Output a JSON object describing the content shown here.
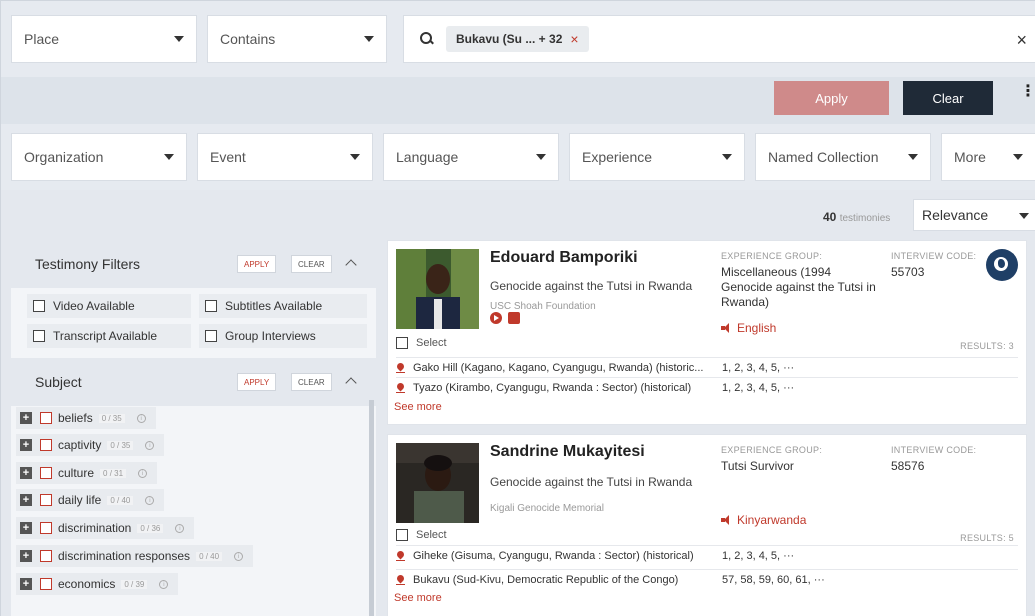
{
  "search": {
    "field_select": "Place",
    "operator_select": "Contains",
    "chip_label": "Bukavu (Su ... + 32",
    "chip_remove": "×",
    "close": "×"
  },
  "actions": {
    "apply_label": "Apply",
    "clear_label": "Clear",
    "more": "⋮"
  },
  "filters": [
    "Organization",
    "Event",
    "Language",
    "Experience",
    "Named Collection",
    "More"
  ],
  "results_meta": {
    "count": "40",
    "count_unit": "testimonies",
    "sort": "Relevance"
  },
  "testimony_filters": {
    "title": "Testimony Filters",
    "apply": "APPLY",
    "clear": "CLEAR",
    "options": [
      "Video Available",
      "Subtitles Available",
      "Transcript Available",
      "Group Interviews"
    ]
  },
  "subject": {
    "title": "Subject",
    "apply": "APPLY",
    "clear": "CLEAR",
    "items": [
      {
        "label": "beliefs",
        "count": "0 / 35"
      },
      {
        "label": "captivity",
        "count": "0 / 35"
      },
      {
        "label": "culture",
        "count": "0 / 31"
      },
      {
        "label": "daily life",
        "count": "0 / 40"
      },
      {
        "label": "discrimination",
        "count": "0 / 36"
      },
      {
        "label": "discrimination responses",
        "count": "0 / 40"
      },
      {
        "label": "economics",
        "count": "0 / 39"
      }
    ]
  },
  "cards": [
    {
      "name": "Edouard Bamporiki",
      "event": "Genocide against the Tutsi in Rwanda",
      "org": "USC Shoah Foundation",
      "exp_label": "EXPERIENCE GROUP:",
      "exp_value": "Miscellaneous (1994 Genocide against the Tutsi in Rwanda)",
      "ic_label": "INTERVIEW CODE:",
      "ic_value": "55703",
      "language": "English",
      "select": "Select",
      "results": "RESULTS: 3",
      "locations": [
        {
          "place": "Gako Hill (Kagano, Kagano, Cyangugu, Rwanda) (historic...",
          "segments": "1, 2, 3, 4, 5, ···"
        },
        {
          "place": "Tyazo (Kirambo, Cyangugu, Rwanda : Sector) (historical)",
          "segments": "1, 2, 3, 4, 5, ···"
        }
      ],
      "see_more": "See more"
    },
    {
      "name": "Sandrine Mukayitesi",
      "event": "Genocide against the Tutsi in Rwanda",
      "org": "Kigali Genocide Memorial",
      "exp_label": "EXPERIENCE GROUP:",
      "exp_value": "Tutsi Survivor",
      "ic_label": "INTERVIEW CODE:",
      "ic_value": "58576",
      "language": "Kinyarwanda",
      "select": "Select",
      "results": "RESULTS: 5",
      "locations": [
        {
          "place": "Giheke (Gisuma, Cyangugu, Rwanda : Sector) (historical)",
          "segments": "1, 2, 3, 4, 5, ···"
        },
        {
          "place": "Bukavu (Sud-Kivu, Democratic Republic of the Congo)",
          "segments": "57, 58, 59, 60, 61, ···"
        }
      ],
      "see_more": "See more"
    }
  ],
  "colors": {
    "accent": "#c0392b",
    "apply_bg": "#cf8a8a",
    "clear_bg": "#1f2a37",
    "page_bg": "#e4e8ee"
  }
}
